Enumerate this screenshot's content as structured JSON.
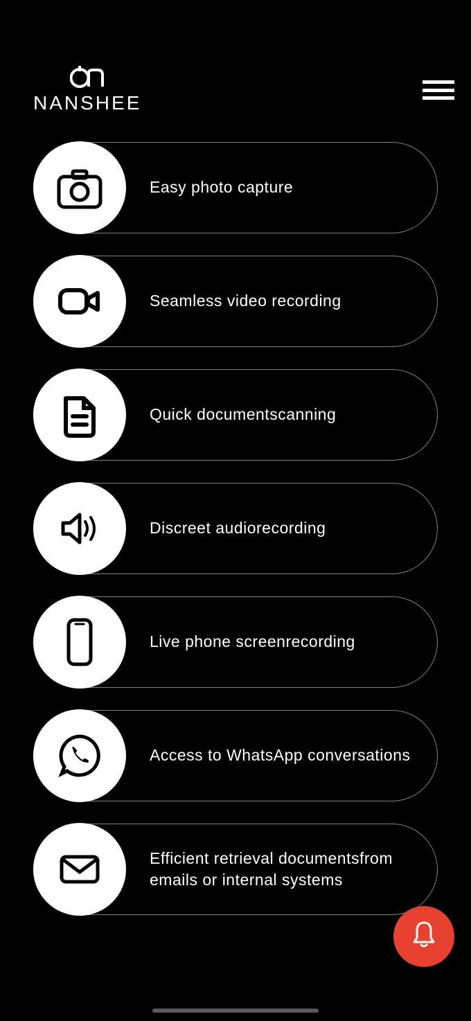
{
  "brand": {
    "name": "NANSHEE"
  },
  "features": [
    {
      "label": "Easy photo capture"
    },
    {
      "label": "Seamless video recording"
    },
    {
      "label": "Quick documentscanning"
    },
    {
      "label": "Discreet audiorecording"
    },
    {
      "label": "Live phone screenrecording"
    },
    {
      "label": "Access to WhatsApp conversations"
    },
    {
      "label": "Efficient retrieval documentsfrom emails or internal systems"
    }
  ]
}
